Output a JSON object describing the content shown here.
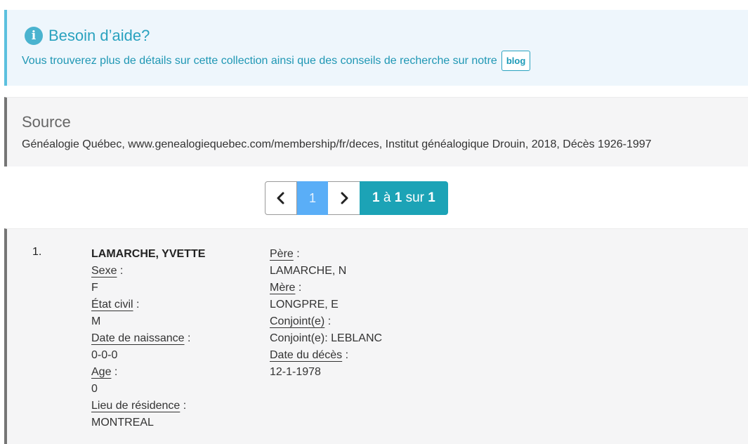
{
  "help": {
    "title": "Besoin d’aide?",
    "text": "Vous trouverez plus de détails sur cette collection ainsi que des conseils de recherche sur notre",
    "blog_label": "blog",
    "icon": "info-icon"
  },
  "source": {
    "title": "Source",
    "text": "Généalogie Québec, www.genealogiequebec.com/membership/fr/deces, Institut généalogique Drouin, 2018, Décès 1926-1997"
  },
  "pagination": {
    "prev_icon": "chevron-left-icon",
    "current_page": "1",
    "next_icon": "chevron-right-icon",
    "summary": {
      "from": "1",
      "a": "à",
      "to": "1",
      "sur": "sur",
      "total": "1"
    }
  },
  "record": {
    "number": "1.",
    "name": "LAMARCHE, YVETTE",
    "sexe_label": "Sexe",
    "sexe": "F",
    "etat_civil_label": "État civil",
    "etat_civil": "M",
    "naissance_label": "Date de naissance",
    "naissance": "0-0-0",
    "age_label": "Age",
    "age": "0",
    "residence_label": "Lieu de résidence",
    "residence": "MONTREAL",
    "pere_label": "Père",
    "pere": "LAMARCHE, N",
    "mere_label": "Mère",
    "mere": "LONGPRE, E",
    "conjoint_label": "Conjoint(e)",
    "conjoint": "Conjoint(e): LEBLANC",
    "deces_label": "Date du décès",
    "deces": "12-1-1978",
    "colon": " :"
  }
}
